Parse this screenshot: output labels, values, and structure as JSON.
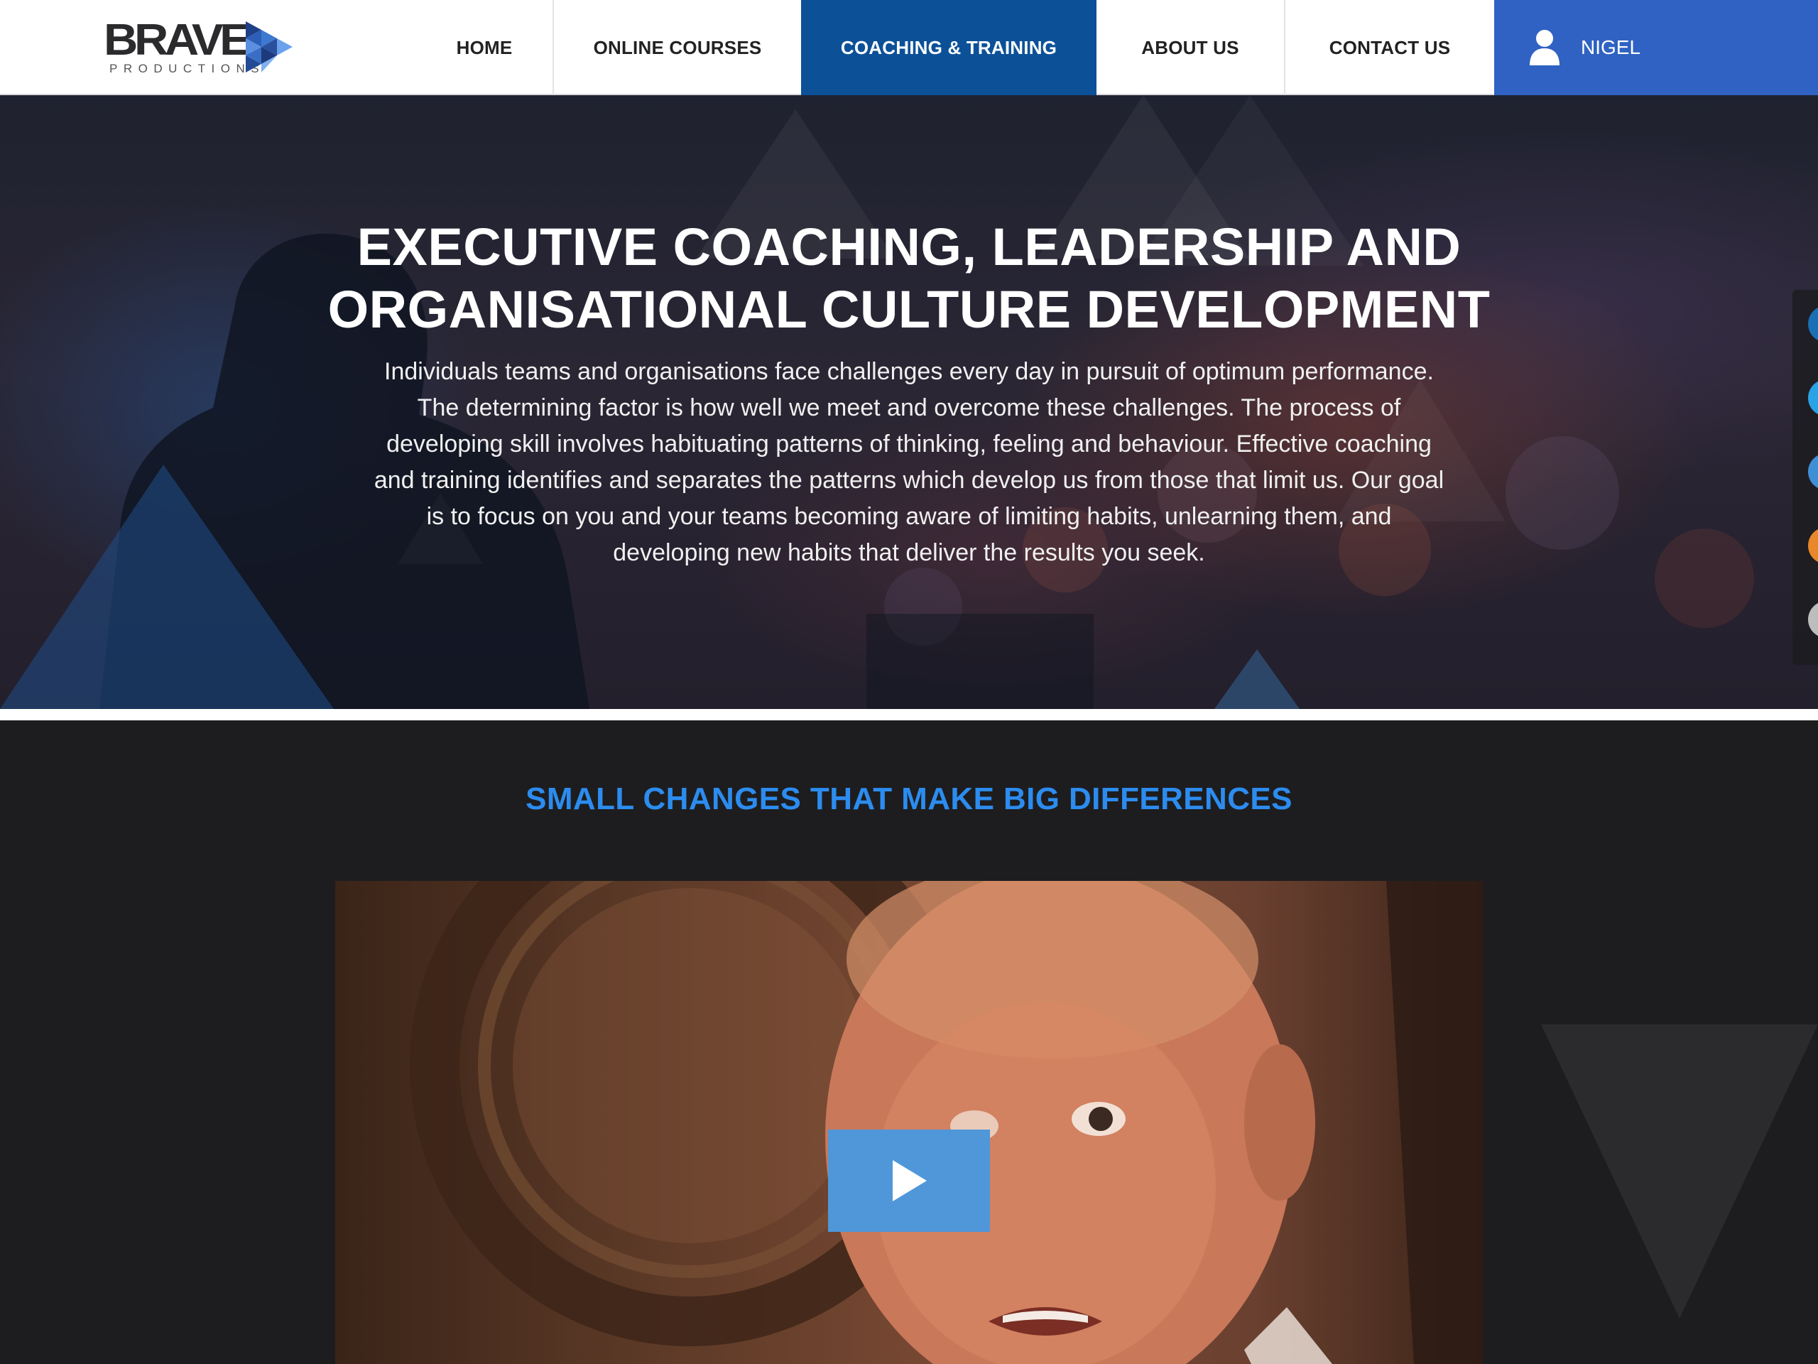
{
  "brand": {
    "name": "BRAVE",
    "subtitle": "PRODUCTIONS"
  },
  "nav": {
    "items": [
      {
        "label": "HOME",
        "active": false
      },
      {
        "label": "ONLINE COURSES",
        "active": false
      },
      {
        "label": "COACHING & TRAINING",
        "active": true
      },
      {
        "label": "ABOUT US",
        "active": false
      },
      {
        "label": "CONTACT US",
        "active": false
      }
    ],
    "user": {
      "name": "NIGEL",
      "icon": "user-icon"
    }
  },
  "hero": {
    "title_line1": "EXECUTIVE COACHING, LEADERSHIP AND",
    "title_line2": "ORGANISATIONAL CULTURE DEVELOPMENT",
    "body": "Individuals teams and organisations face challenges every day in pursuit of optimum performance. The determining factor is how well we meet and overcome these challenges. The process of developing skill involves habituating patterns of thinking, feeling and behaviour. Effective coaching and training identifies and separates the patterns which develop us from those that limit us. Our goal is to focus on you and your teams becoming aware of limiting habits, unlearning them, and developing new habits that deliver the results you seek."
  },
  "side_social": [
    {
      "icon": "social-icon",
      "color": "#1a6fb5"
    },
    {
      "icon": "social-icon",
      "color": "#2aa3e6"
    },
    {
      "icon": "social-icon",
      "color": "#3f8fd6"
    },
    {
      "icon": "social-icon",
      "color": "#e8882a"
    },
    {
      "icon": "social-icon",
      "color": "#bdbdbd"
    }
  ],
  "section": {
    "heading": "SMALL CHANGES THAT MAKE BIG DIFFERENCES"
  },
  "video": {
    "play_icon": "play-icon"
  },
  "colors": {
    "nav_active": "#0c5198",
    "user_bg": "#2f62c2",
    "heading_blue": "#2c8cef",
    "play_button": "#4f97d9",
    "page_dark": "#1d1d1f"
  }
}
